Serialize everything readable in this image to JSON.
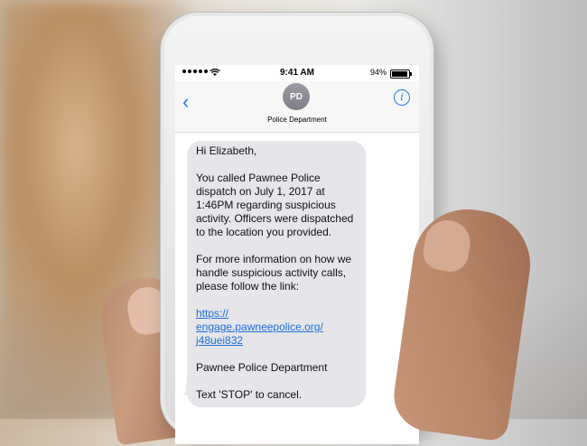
{
  "status_bar": {
    "time": "9:41 AM",
    "battery": "94%",
    "battery_level": 0.94
  },
  "nav": {
    "avatar_initials": "PD",
    "contact_name": "Police Department",
    "info_symbol": "i",
    "back_symbol": "‹"
  },
  "message": {
    "greeting": "Hi Elizabeth,",
    "body1": "You called Pawnee Police dispatch on July 1, 2017 at 1:46PM regarding suspicious activity. Officers were dispatched to the location you provided.",
    "body2": "For more information on how we handle suspicious activity calls, please follow the link:",
    "link_line1": "https://",
    "link_line2": "engage.pawneepolice.org/",
    "link_line3": "j48uei832",
    "signature": "Pawnee Police Department",
    "footer": "Text 'STOP' to cancel."
  },
  "colors": {
    "accent": "#1a7cf5",
    "bubble": "#e5e5ea",
    "link": "#1a6fd8"
  },
  "icons": {
    "back": "chevron-left-icon",
    "info": "info-icon",
    "wifi": "wifi-icon",
    "signal": "signal-icon",
    "battery": "battery-icon"
  }
}
